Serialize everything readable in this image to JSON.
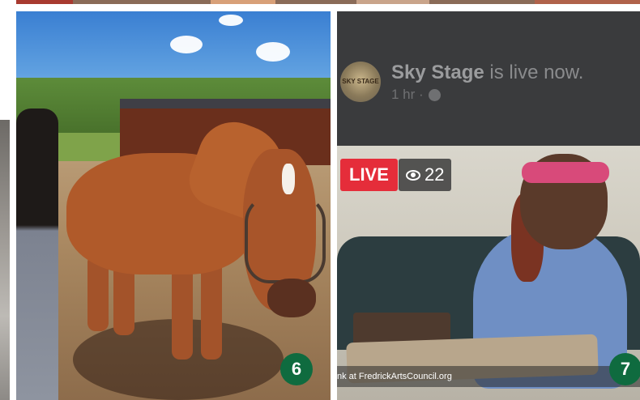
{
  "colors": {
    "badge_bg": "#0f6b3f",
    "live_red": "#e52d3a",
    "fb_bg": "#3a3b3d"
  },
  "tiles": [
    {
      "badge_number": "6"
    },
    {
      "badge_number": "7",
      "page_name": "Sky Stage",
      "status_text": "is live now.",
      "time_ago": "1 hr ·",
      "privacy_icon": "globe-icon",
      "live_label": "LIVE",
      "viewer_count": "22",
      "viewer_icon": "eye-icon",
      "avatar_text": "SKY STAGE",
      "video_caption": "nk at FredrickArtsCouncil.org"
    }
  ]
}
